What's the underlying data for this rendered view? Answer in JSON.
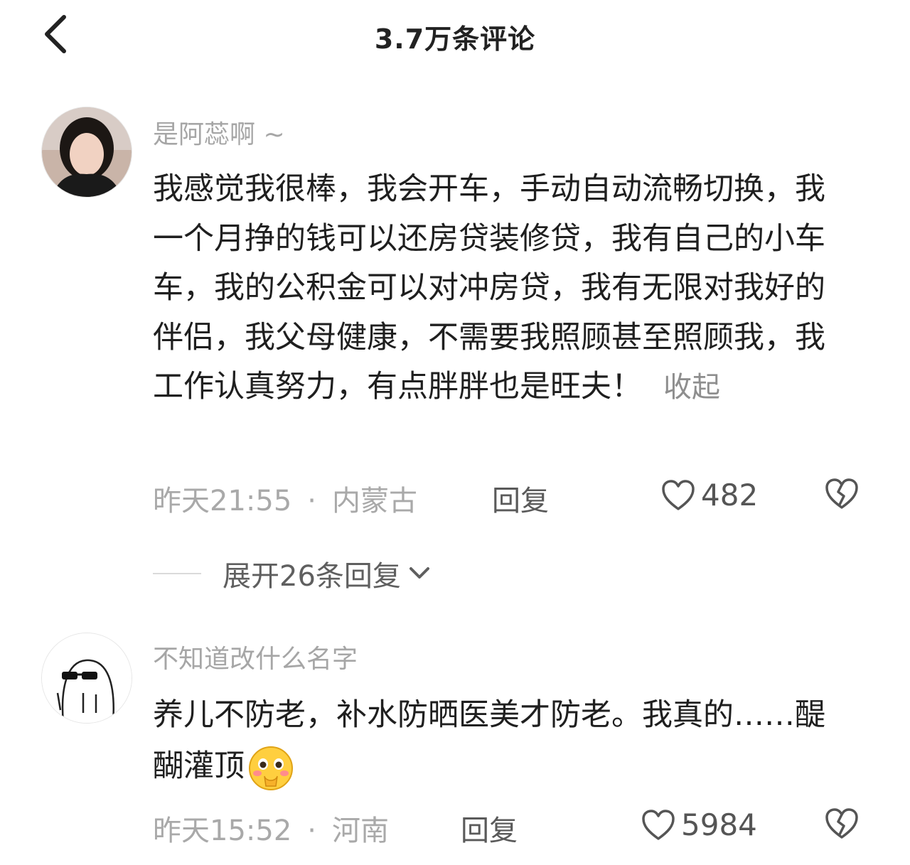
{
  "header": {
    "title": "3.7万条评论",
    "back_icon": "chevron-left-icon"
  },
  "comments": [
    {
      "username": "是阿蕊啊 ~",
      "text": "我感觉我很棒，我会开车，手动自动流畅切换，我一个月挣的钱可以还房贷装修贷，我有自己的小车车，我的公积金可以对冲房贷，我有无限对我好的伴侣，我父母健康，不需要我照顾甚至照顾我，我工作认真努力，有点胖胖也是旺夫！",
      "collapse_label": "收起",
      "time": "昨天21:55",
      "dot": "·",
      "location": "内蒙古",
      "reply_label": "回复",
      "likes": "482",
      "expand_label": "展开26条回复"
    },
    {
      "username": "不知道改什么名字",
      "text": "养儿不防老，补水防晒医美才防老。我真的……醍醐灌顶",
      "emoji": "shy-blush-emoji",
      "time": "昨天15:52",
      "dot": "·",
      "location": "河南",
      "reply_label": "回复",
      "likes": "5984"
    }
  ],
  "colors": {
    "username": "#a6a6a6",
    "meta": "#a9a9a9",
    "body": "#1f1f1f"
  }
}
